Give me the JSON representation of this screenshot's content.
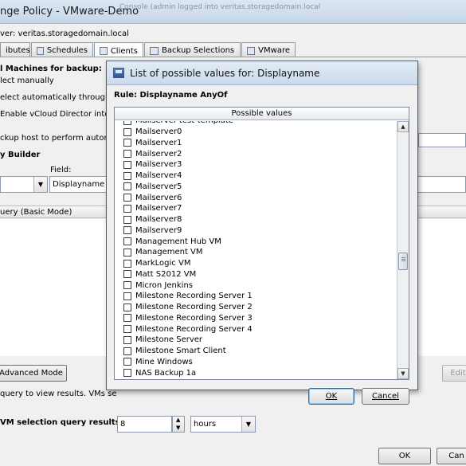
{
  "window": {
    "title": "nge Policy - VMware-Demo",
    "ghost_title": "Console (admin logged into veritas.storagedomain.local"
  },
  "server_label": "ver: veritas.storagedomain.local",
  "tabs": [
    {
      "label": "ibutes",
      "icon": "attributes-icon"
    },
    {
      "label": "Schedules",
      "icon": "schedules-icon"
    },
    {
      "label": "Clients",
      "icon": "clients-icon",
      "active": true
    },
    {
      "label": "Backup Selections",
      "icon": "backup-selections-icon"
    },
    {
      "label": "VMware",
      "icon": "vmware-icon"
    }
  ],
  "vm_backup": {
    "heading": "l Machines for backup:",
    "select_manually": "lect manually",
    "select_auto": "elect automatically through VM",
    "vcloud": "Enable vCloud Director integr",
    "backup_host": "ckup host to perform automa",
    "query_builder": "y Builder"
  },
  "field_label": "Field:",
  "field_value": "Displayname",
  "query_mode": "uery (Basic Mode)",
  "advanced_mode_button": "Advanced Mode",
  "edit_button": "Edit",
  "query_hint": "query to view results. VMs se",
  "reuse_label": "VM selection query results for:",
  "reuse_value": "8",
  "reuse_unit": "hours",
  "main_ok": "OK",
  "main_cancel": "Can",
  "dialog": {
    "title": "List of possible values for: Displayname",
    "rule": "Rule: Displayname AnyOf",
    "list_header": "Possible values",
    "items": [
      "Mailserver-test-template",
      "Mailserver0",
      "Mailserver1",
      "Mailserver2",
      "Mailserver3",
      "Mailserver4",
      "Mailserver5",
      "Mailserver6",
      "Mailserver7",
      "Mailserver8",
      "Mailserver9",
      "Management Hub VM",
      "Management VM",
      "MarkLogic VM",
      "Matt S2012 VM",
      "Micron Jenkins",
      "Milestone Recording Server 1",
      "Milestone Recording Server 2",
      "Milestone Recording Server 3",
      "Milestone Recording Server 4",
      "Milestone Server",
      "Milestone Smart Client",
      "Mine Windows",
      "NAS Backup 1a"
    ],
    "ok_label": "OK",
    "cancel_label": "Cancel",
    "scroll_position": 0.55
  }
}
